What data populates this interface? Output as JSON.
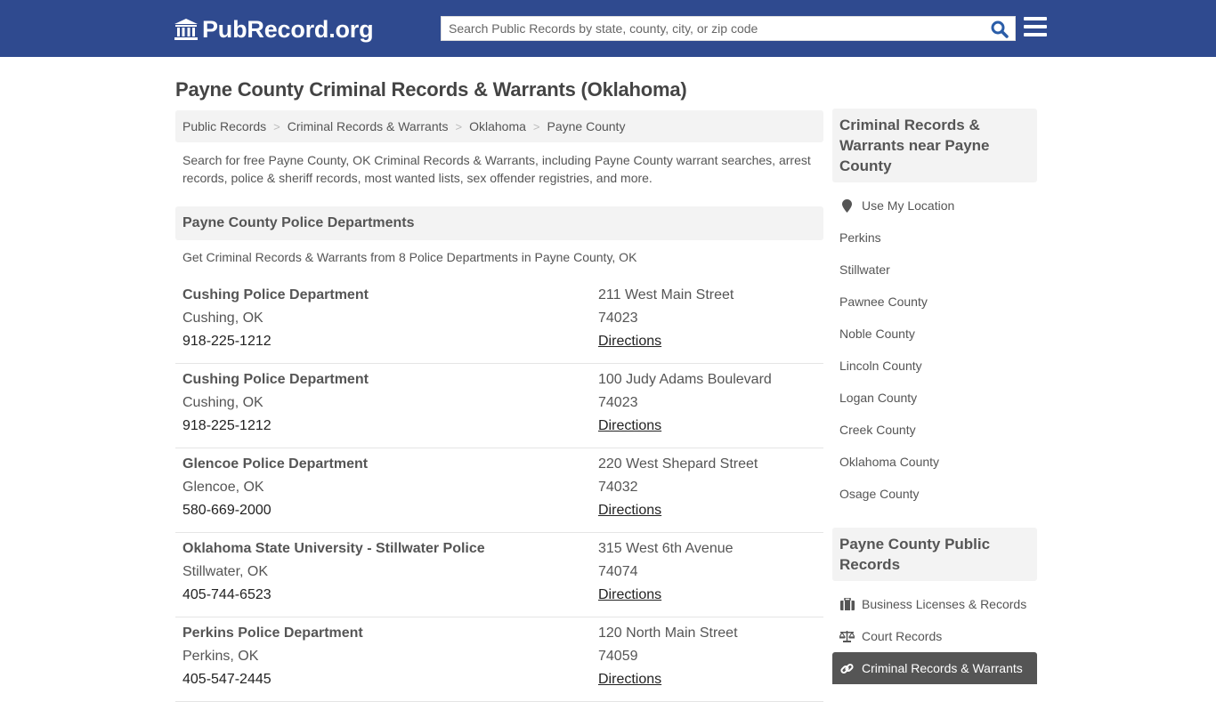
{
  "header": {
    "logo_text": "PubRecord.org",
    "search_placeholder": "Search Public Records by state, county, city, or zip code",
    "brand_color": "#2f4a8f"
  },
  "page": {
    "title": "Payne County Criminal Records & Warrants (Oklahoma)",
    "breadcrumb": [
      "Public Records",
      "Criminal Records & Warrants",
      "Oklahoma",
      "Payne County"
    ],
    "intro": "Search for free Payne County, OK Criminal Records & Warrants, including Payne County warrant searches, arrest records, police & sheriff records, most wanted lists, sex offender registries, and more."
  },
  "section": {
    "title": "Payne County Police Departments",
    "subtitle": "Get Criminal Records & Warrants from 8 Police Departments in Payne County, OK",
    "directions_label": "Directions",
    "departments": [
      {
        "name": "Cushing Police Department",
        "city": "Cushing, OK",
        "phone": "918-225-1212",
        "address": "211 West Main Street",
        "zip": "74023"
      },
      {
        "name": "Cushing Police Department",
        "city": "Cushing, OK",
        "phone": "918-225-1212",
        "address": "100 Judy Adams Boulevard",
        "zip": "74023"
      },
      {
        "name": "Glencoe Police Department",
        "city": "Glencoe, OK",
        "phone": "580-669-2000",
        "address": "220 West Shepard Street",
        "zip": "74032"
      },
      {
        "name": "Oklahoma State University - Stillwater Police",
        "city": "Stillwater, OK",
        "phone": "405-744-6523",
        "address": "315 West 6th Avenue",
        "zip": "74074"
      },
      {
        "name": "Perkins Police Department",
        "city": "Perkins, OK",
        "phone": "405-547-2445",
        "address": "120 North Main Street",
        "zip": "74059"
      }
    ]
  },
  "sidebar": {
    "nearby_title": "Criminal Records & Warrants near Payne County",
    "use_location": "Use My Location",
    "nearby": [
      "Perkins",
      "Stillwater",
      "Pawnee County",
      "Noble County",
      "Lincoln County",
      "Logan County",
      "Creek County",
      "Oklahoma County",
      "Osage County"
    ],
    "public_title": "Payne County Public Records",
    "public_items": [
      {
        "label": "Business Licenses & Records",
        "icon": "briefcase-icon"
      },
      {
        "label": "Court Records",
        "icon": "scales-icon"
      },
      {
        "label": "Criminal Records & Warrants",
        "icon": "link-icon",
        "active": true
      }
    ]
  }
}
